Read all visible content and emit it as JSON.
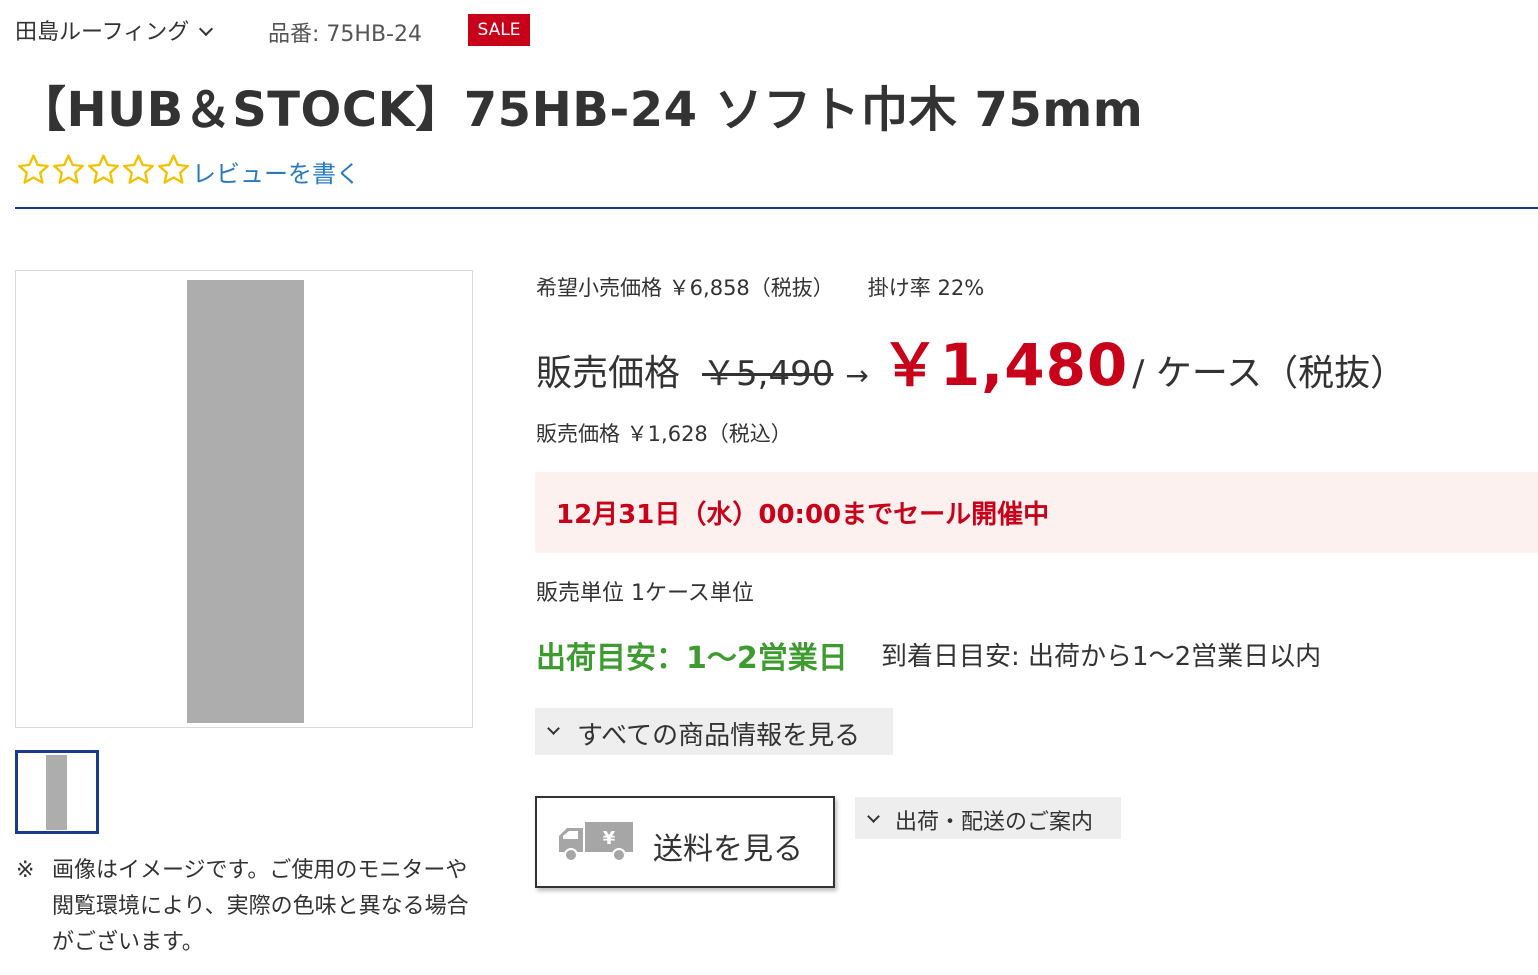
{
  "header": {
    "brand": "田島ルーフィング",
    "sku": "品番: 75HB-24",
    "sale_badge": "SALE",
    "title": "【HUB＆STOCK】75HB-24 ソフト巾木 75mm",
    "rating": 0,
    "rating_max": 5,
    "review_link": "レビューを書く"
  },
  "gallery": {
    "note_mark": "※",
    "note": "画像はイメージです。ご使用のモニターや閲覧環境により、実際の色味と異なる場合がございます。"
  },
  "pricing": {
    "list_price": "希望小売価格 ￥6,858（税抜）",
    "rate": "掛け率 22%",
    "price_label": "販売価格",
    "old_price": "￥5,490",
    "arrow": "→",
    "sale_price": "￥1,480",
    "unit": "/ ケース（税抜）",
    "tax_included": "販売価格 ￥1,628（税込）",
    "sale_banner": "12月31日（水）00:00までセール開催中",
    "sales_unit": "販売単位 1ケース単位",
    "ship_estimate": "出荷目安：1〜2営業日",
    "arrival_estimate": "到着日目安: 出荷から1〜2営業日以内"
  },
  "actions": {
    "all_info": "すべての商品情報を見る",
    "shipping_fee": "送料を見る",
    "delivery_guide": "出荷・配送のご案内"
  },
  "colors": {
    "sale_red": "#c8001a",
    "ship_green": "#3d9b2f",
    "navy": "#1a3a8a",
    "link_blue": "#2a7ac0",
    "star_gold": "#f2c200"
  }
}
